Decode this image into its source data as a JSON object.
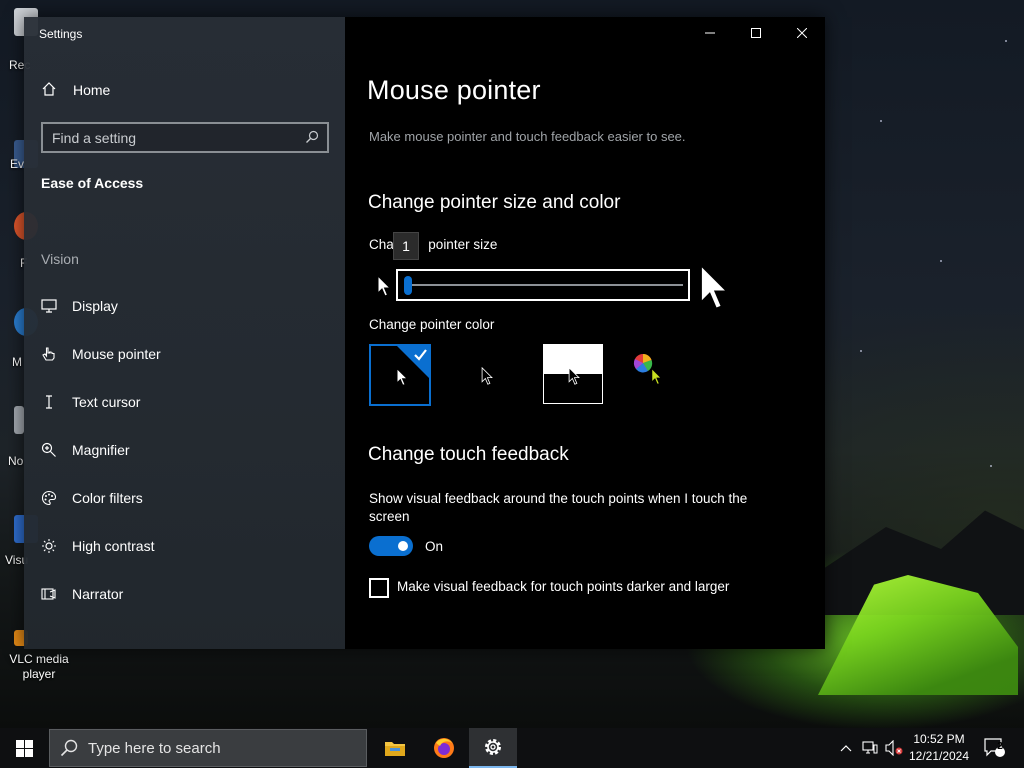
{
  "window": {
    "title": "Settings"
  },
  "sidebar": {
    "home_label": "Home",
    "search_placeholder": "Find a setting",
    "section_title": "Ease of Access",
    "group_label": "Vision",
    "items": [
      {
        "label": "Display",
        "icon": "monitor-icon"
      },
      {
        "label": "Mouse pointer",
        "icon": "hand-pointer-icon"
      },
      {
        "label": "Text cursor",
        "icon": "text-cursor-icon"
      },
      {
        "label": "Magnifier",
        "icon": "magnifier-icon"
      },
      {
        "label": "Color filters",
        "icon": "palette-icon"
      },
      {
        "label": "High contrast",
        "icon": "sun-icon"
      },
      {
        "label": "Narrator",
        "icon": "narrator-icon"
      }
    ]
  },
  "main": {
    "title": "Mouse pointer",
    "description": "Make mouse pointer and touch feedback easier to see.",
    "pointer_section_title": "Change pointer size and color",
    "size_label_prefix": "Cha",
    "size_label_suffix": "pointer size",
    "size_tooltip_value": "1",
    "size_value": 1,
    "color_label": "Change pointer color",
    "color_options": [
      "white",
      "black",
      "inverted",
      "custom"
    ],
    "selected_color": "white",
    "touch_section_title": "Change touch feedback",
    "touch_feedback_label": "Show visual feedback around the touch points when I touch the screen",
    "touch_toggle_state": "On",
    "touch_toggle_on": true,
    "darker_label": "Make visual feedback for touch points darker and larger",
    "darker_checked": false
  },
  "desktop": {
    "icons": [
      {
        "label": "Rec"
      },
      {
        "label": "Ev"
      },
      {
        "label": "F"
      },
      {
        "label": "M"
      },
      {
        "label": "No"
      },
      {
        "label": "Visu"
      },
      {
        "label": "VLC media player"
      }
    ]
  },
  "taskbar": {
    "search_placeholder": "Type here to search",
    "time": "10:52 PM",
    "date": "12/21/2024",
    "notification_count": "2"
  },
  "colors": {
    "accent": "#0a6fd0",
    "sidebar_bg": "#262c33",
    "content_bg": "#000000"
  }
}
